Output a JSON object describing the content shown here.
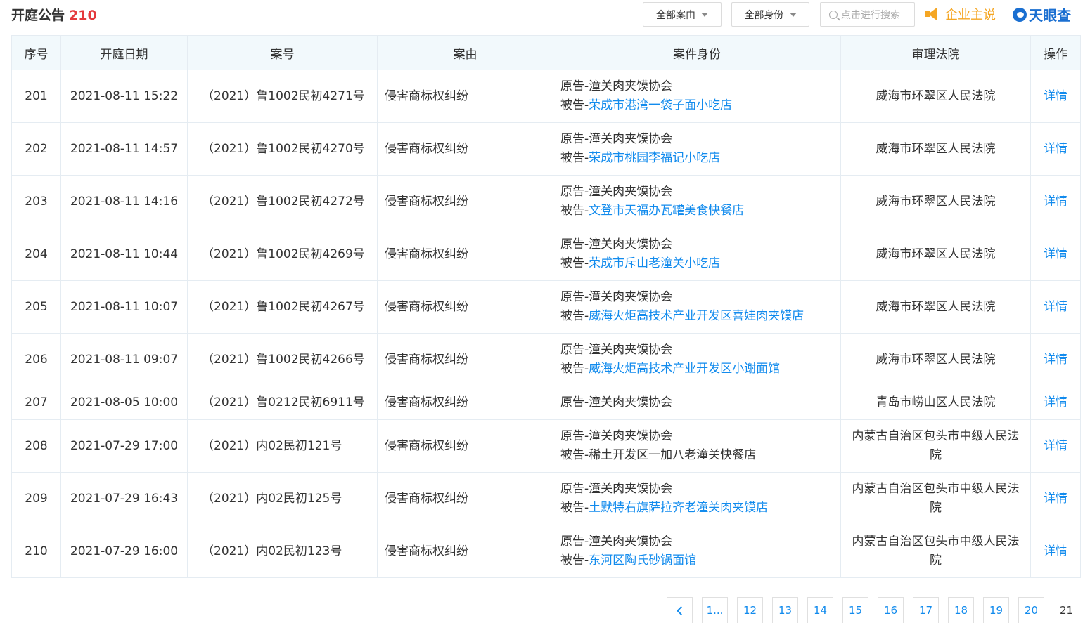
{
  "header": {
    "title": "开庭公告",
    "count": "210",
    "case_filter": "全部案由",
    "role_filter": "全部身份",
    "search_placeholder": "点击进行搜索",
    "company_say": "企业主说",
    "logo": "天眼查"
  },
  "table": {
    "columns": [
      "序号",
      "开庭日期",
      "案号",
      "案由",
      "案件身份",
      "审理法院",
      "操作"
    ],
    "rows": [
      {
        "no": "201",
        "date": "2021-08-11 15:22",
        "case_no": "（2021）鲁1002民初4271号",
        "cause": "侵害商标权纠纷",
        "plaintiff": "原告-潼关肉夹馍协会",
        "defendant_prefix": "被告-",
        "defendant": "荣成市港湾一袋子面小吃店",
        "defendant_link": true,
        "court": "威海市环翠区人民法院",
        "action": "详情"
      },
      {
        "no": "202",
        "date": "2021-08-11 14:57",
        "case_no": "（2021）鲁1002民初4270号",
        "cause": "侵害商标权纠纷",
        "plaintiff": "原告-潼关肉夹馍协会",
        "defendant_prefix": "被告-",
        "defendant": "荣成市桃园李福记小吃店",
        "defendant_link": true,
        "court": "威海市环翠区人民法院",
        "action": "详情"
      },
      {
        "no": "203",
        "date": "2021-08-11 14:16",
        "case_no": "（2021）鲁1002民初4272号",
        "cause": "侵害商标权纠纷",
        "plaintiff": "原告-潼关肉夹馍协会",
        "defendant_prefix": "被告-",
        "defendant": "文登市天福办瓦罐美食快餐店",
        "defendant_link": true,
        "court": "威海市环翠区人民法院",
        "action": "详情"
      },
      {
        "no": "204",
        "date": "2021-08-11 10:44",
        "case_no": "（2021）鲁1002民初4269号",
        "cause": "侵害商标权纠纷",
        "plaintiff": "原告-潼关肉夹馍协会",
        "defendant_prefix": "被告-",
        "defendant": "荣成市斥山老潼关小吃店",
        "defendant_link": true,
        "court": "威海市环翠区人民法院",
        "action": "详情"
      },
      {
        "no": "205",
        "date": "2021-08-11 10:07",
        "case_no": "（2021）鲁1002民初4267号",
        "cause": "侵害商标权纠纷",
        "plaintiff": "原告-潼关肉夹馍协会",
        "defendant_prefix": "被告-",
        "defendant": "威海火炬高技术产业开发区喜娃肉夹馍店",
        "defendant_link": true,
        "court": "威海市环翠区人民法院",
        "action": "详情"
      },
      {
        "no": "206",
        "date": "2021-08-11 09:07",
        "case_no": "（2021）鲁1002民初4266号",
        "cause": "侵害商标权纠纷",
        "plaintiff": "原告-潼关肉夹馍协会",
        "defendant_prefix": "被告-",
        "defendant": "威海火炬高技术产业开发区小谢面馆",
        "defendant_link": true,
        "court": "威海市环翠区人民法院",
        "action": "详情"
      },
      {
        "no": "207",
        "date": "2021-08-05 10:00",
        "case_no": "（2021）鲁0212民初6911号",
        "cause": "侵害商标权纠纷",
        "plaintiff": "原告-潼关肉夹馍协会",
        "defendant_prefix": "",
        "defendant": "",
        "defendant_link": false,
        "court": "青岛市崂山区人民法院",
        "action": "详情"
      },
      {
        "no": "208",
        "date": "2021-07-29 17:00",
        "case_no": "（2021）内02民初121号",
        "cause": "侵害商标权纠纷",
        "plaintiff": "原告-潼关肉夹馍协会",
        "defendant_prefix": "被告-",
        "defendant": "稀土开发区一加八老潼关快餐店",
        "defendant_link": false,
        "court": "内蒙古自治区包头市中级人民法院",
        "action": "详情"
      },
      {
        "no": "209",
        "date": "2021-07-29 16:43",
        "case_no": "（2021）内02民初125号",
        "cause": "侵害商标权纠纷",
        "plaintiff": "原告-潼关肉夹馍协会",
        "defendant_prefix": "被告-",
        "defendant": "土默特右旗萨拉齐老潼关肉夹馍店",
        "defendant_link": true,
        "court": "内蒙古自治区包头市中级人民法院",
        "action": "详情"
      },
      {
        "no": "210",
        "date": "2021-07-29 16:00",
        "case_no": "（2021）内02民初123号",
        "cause": "侵害商标权纠纷",
        "plaintiff": "原告-潼关肉夹馍协会",
        "defendant_prefix": "被告-",
        "defendant": "东河区陶氏砂锅面馆",
        "defendant_link": true,
        "court": "内蒙古自治区包头市中级人民法院",
        "action": "详情"
      }
    ]
  },
  "pagination": {
    "prev_icon": "chevron-left-icon",
    "pages": [
      "1...",
      "12",
      "13",
      "14",
      "15",
      "16",
      "17",
      "18",
      "19",
      "20"
    ],
    "current": "21"
  },
  "colors": {
    "link": "#128bed",
    "count": "#e4393c",
    "header_bg": "#f2f9fc",
    "accent_orange": "#f5a623",
    "logo_blue": "#1a6fd1"
  }
}
